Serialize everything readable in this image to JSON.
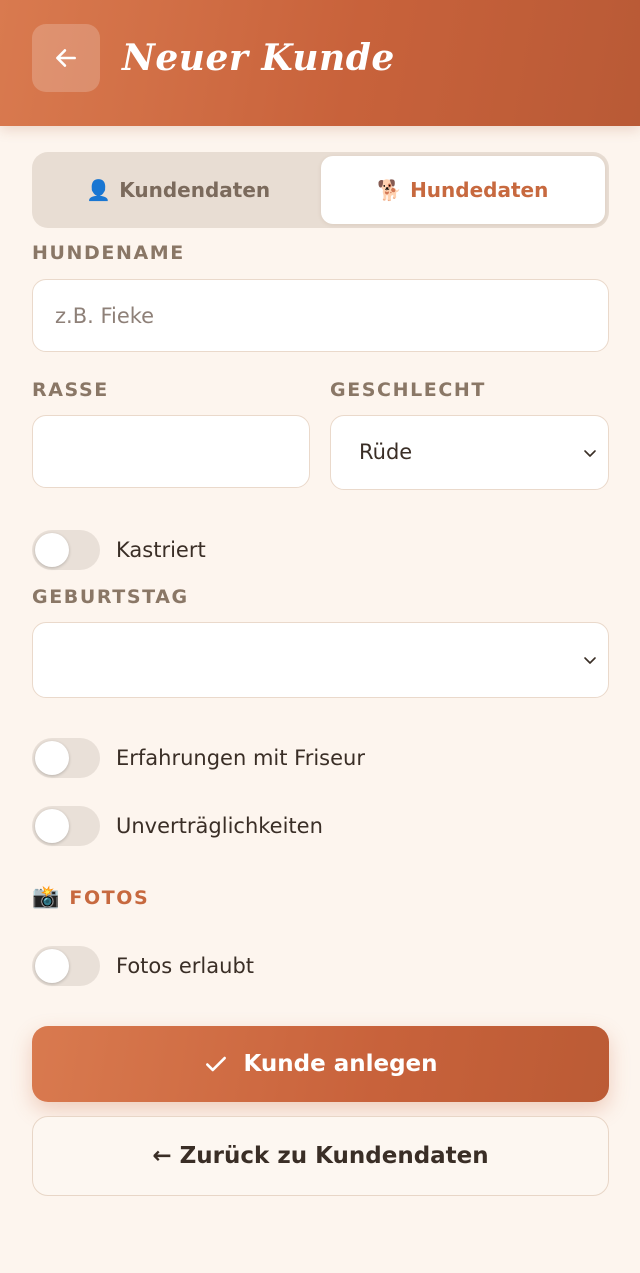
{
  "header": {
    "title": "Neuer Kunde",
    "back_icon": "arrow-left-icon"
  },
  "tabs": [
    {
      "icon": "👤",
      "icon_name": "person-icon",
      "label": "Kundendaten",
      "active": false
    },
    {
      "icon": "🐕",
      "icon_name": "dog-icon",
      "label": "Hundedaten",
      "active": true
    }
  ],
  "form": {
    "hundename": {
      "label": "HUNDENAME",
      "placeholder": "z.B. Fieke",
      "value": ""
    },
    "rasse": {
      "label": "RASSE",
      "value": ""
    },
    "geschlecht": {
      "label": "GESCHLECHT",
      "value": "Rüde"
    },
    "kastriert": {
      "label": "Kastriert",
      "checked": false
    },
    "geburtstag": {
      "label": "GEBURTSTAG",
      "value": ""
    },
    "friseur": {
      "label": "Erfahrungen mit Friseur",
      "checked": false
    },
    "unvertraeglichkeiten": {
      "label": "Unverträglichkeiten",
      "checked": false
    }
  },
  "fotos": {
    "title": "FOTOS",
    "icon": "📸",
    "icon_name": "camera-icon",
    "toggle": {
      "label": "Fotos erlaubt",
      "checked": false
    }
  },
  "actions": {
    "primary": "Kunde anlegen",
    "secondary": "← Zurück zu Kundendaten"
  },
  "colors": {
    "accent": "#c7693f",
    "header": "#c8623b",
    "background": "#fdf5ee"
  }
}
